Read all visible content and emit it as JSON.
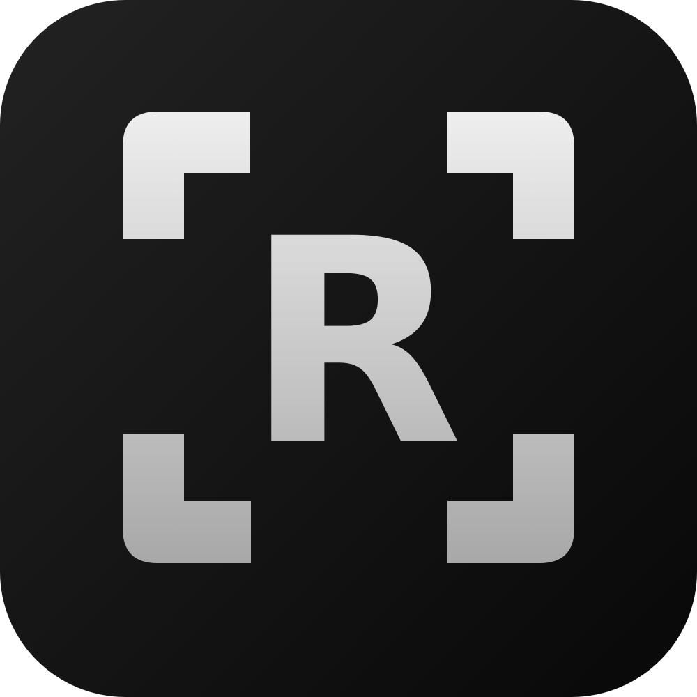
{
  "app_icon": {
    "name": "app-icon",
    "letter": "R",
    "colors": {
      "tile_top": "#222222",
      "tile_bottom": "#080808",
      "glyph_top": "#eeeeee",
      "glyph_bottom": "#a8a8a8"
    }
  }
}
